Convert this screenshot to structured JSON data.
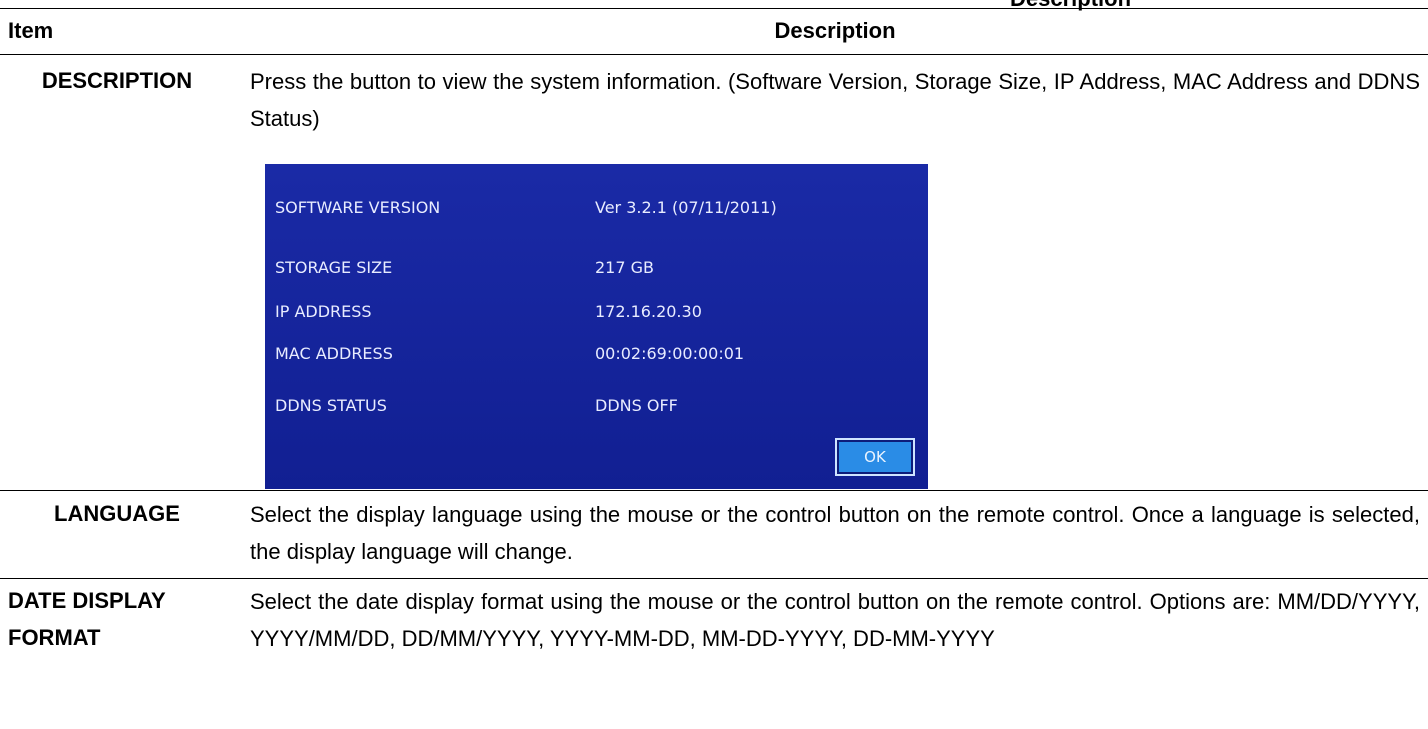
{
  "page": {
    "clipped_title": "Description"
  },
  "table": {
    "header": {
      "item": "Item",
      "description": "Description"
    },
    "rows": [
      {
        "item": "DESCRIPTION",
        "description": "Press the button to view the system information. (Software Version, Storage Size, IP Address, MAC Address and DDNS Status)"
      },
      {
        "item": "LANGUAGE",
        "description": "Select the display language using the mouse or the control button on the remote control. Once a language is selected, the display language will change."
      },
      {
        "item_line1": "DATE DISPLAY",
        "item_line2": "FORMAT",
        "description": "Select the date display format using the mouse or the control button on the remote control. Options are: MM/DD/YYYY, YYYY/MM/DD, DD/MM/YYYY, YYYY-MM-DD, MM-DD-YYYY, DD-MM-YYYY"
      }
    ]
  },
  "system_info_dialog": {
    "fields": [
      {
        "label": "SOFTWARE VERSION",
        "value": "Ver 3.2.1 (07/11/2011)"
      },
      {
        "label": "STORAGE SIZE",
        "value": "217 GB"
      },
      {
        "label": "IP ADDRESS",
        "value": "172.16.20.30"
      },
      {
        "label": "MAC ADDRESS",
        "value": "00:02:69:00:00:01"
      },
      {
        "label": "DDNS STATUS",
        "value": "DDNS OFF"
      }
    ],
    "ok_label": "OK",
    "colors": {
      "background": "#15229a",
      "button": "#2a8ce6"
    }
  }
}
